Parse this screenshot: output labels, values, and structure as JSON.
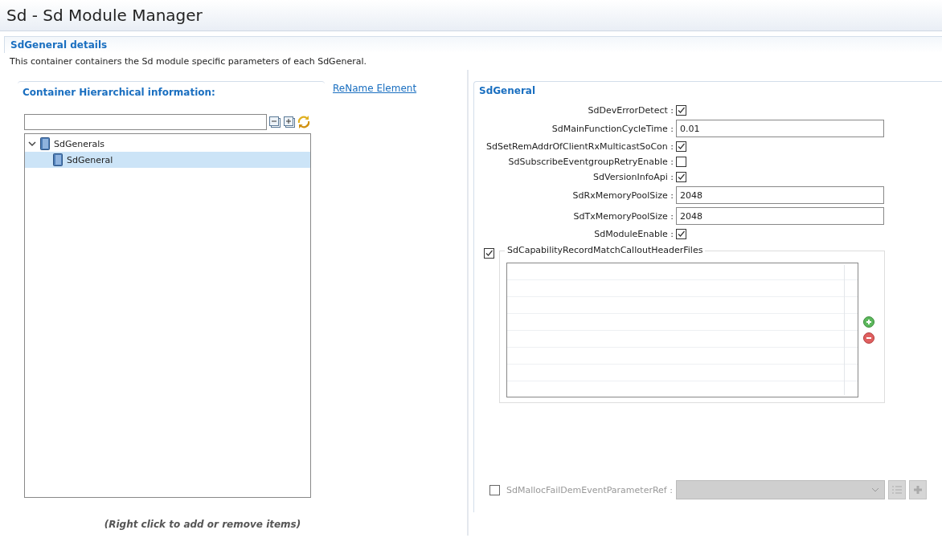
{
  "window": {
    "title": "Sd - Sd Module Manager"
  },
  "details": {
    "title": "SdGeneral details",
    "description": "This container containers the Sd module specific parameters of each SdGeneral."
  },
  "hierarchy": {
    "title": "Container Hierarchical information:",
    "rename_link": "ReName Element",
    "tree": [
      {
        "label": "SdGenerals",
        "expanded": true,
        "selected": false,
        "children": [
          {
            "label": "SdGeneral",
            "selected": true
          }
        ]
      }
    ],
    "hint": "(Right click to add or remove items)"
  },
  "form": {
    "title": "SdGeneral",
    "params": [
      {
        "kind": "checkbox",
        "label": "SdDevErrorDetect :",
        "checked": true
      },
      {
        "kind": "text",
        "label": "SdMainFunctionCycleTime :",
        "value": "0.01"
      },
      {
        "kind": "checkbox",
        "label": "SdSetRemAddrOfClientRxMulticastSoCon :",
        "checked": true
      },
      {
        "kind": "checkbox",
        "label": "SdSubscribeEventgroupRetryEnable :",
        "checked": false
      },
      {
        "kind": "checkbox",
        "label": "SdVersionInfoApi :",
        "checked": true
      },
      {
        "kind": "text",
        "label": "SdRxMemoryPoolSize :",
        "value": "2048"
      },
      {
        "kind": "text",
        "label": "SdTxMemoryPoolSize :",
        "value": "2048"
      },
      {
        "kind": "checkbox",
        "label": "SdModuleEnable :",
        "checked": true
      }
    ],
    "list_group": {
      "label": "SdCapabilityRecordMatchCalloutHeaderFiles",
      "checked": true
    },
    "reference": {
      "label": "SdMallocFailDemEventParameterRef :",
      "checked": false,
      "disabled": true
    }
  }
}
